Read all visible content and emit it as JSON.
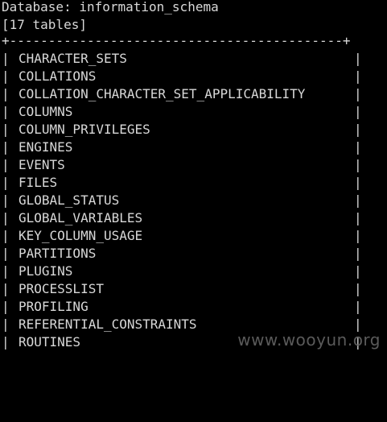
{
  "header": {
    "database_line": "Database: information_schema",
    "count_line": "[17 tables]"
  },
  "table": {
    "border": "+-------------------------------------------+",
    "pipe": "|",
    "rows": [
      "CHARACTER_SETS",
      "COLLATIONS",
      "COLLATION_CHARACTER_SET_APPLICABILITY",
      "COLUMNS",
      "COLUMN_PRIVILEGES",
      "ENGINES",
      "EVENTS",
      "FILES",
      "GLOBAL_STATUS",
      "GLOBAL_VARIABLES",
      "KEY_COLUMN_USAGE",
      "PARTITIONS",
      "PLUGINS",
      "PROCESSLIST",
      "PROFILING",
      "REFERENTIAL_CONSTRAINTS",
      "ROUTINES"
    ]
  },
  "watermark": {
    "text": "www.wooyun.org"
  },
  "colors": {
    "background": "#000000",
    "text": "#d8d8d8",
    "watermark": "#5a5a5a"
  }
}
